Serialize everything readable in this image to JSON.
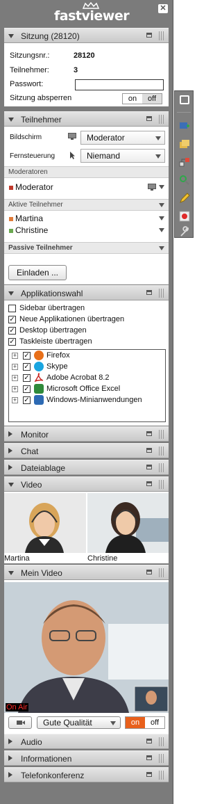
{
  "app": {
    "logo": "fastviewer",
    "close_glyph": "✕"
  },
  "sitzung": {
    "title": "Sitzung (28120)",
    "nr_label": "Sitzungsnr.:",
    "nr_value": "28120",
    "teilnehmer_label": "Teilnehmer:",
    "teilnehmer_value": "3",
    "passwort_label": "Passwort:",
    "passwort_value": "",
    "absperren_label": "Sitzung absperren",
    "on": "on",
    "off": "off"
  },
  "teilnehmer": {
    "title": "Teilnehmer",
    "bildschirm_label": "Bildschirm",
    "bildschirm_value": "Moderator",
    "fernsteuerung_label": "Fernsteuerung",
    "fernsteuerung_value": "Niemand",
    "moderatoren_header": "Moderatoren",
    "moderator": "Moderator",
    "aktive_header": "Aktive Teilnehmer",
    "aktive": [
      "Martina",
      "Christine"
    ],
    "passive_header": "Passive Teilnehmer",
    "einladen": "Einladen ..."
  },
  "applikationswahl": {
    "title": "Applikationswahl",
    "options": [
      {
        "label": "Sidebar übertragen",
        "checked": false
      },
      {
        "label": "Neue Applikationen übertragen",
        "checked": true
      },
      {
        "label": "Desktop übertragen",
        "checked": true
      },
      {
        "label": "Taskleiste übertragen",
        "checked": true
      }
    ],
    "apps": [
      {
        "label": "Firefox",
        "icon": "firefox-icon",
        "color": "#e8701a"
      },
      {
        "label": "Skype",
        "icon": "skype-icon",
        "color": "#1aa5e0"
      },
      {
        "label": "Adobe Acrobat 8.2",
        "icon": "acrobat-icon",
        "color": "#c8231f"
      },
      {
        "label": "Microsoft Office Excel",
        "icon": "excel-icon",
        "color": "#2f8a3a"
      },
      {
        "label": "Windows-Minianwendungen",
        "icon": "gadgets-icon",
        "color": "#2d6ab3"
      }
    ]
  },
  "sections": {
    "monitor": "Monitor",
    "chat": "Chat",
    "dateiablage": "Dateiablage",
    "video": "Video",
    "mein_video": "Mein Video",
    "audio": "Audio",
    "informationen": "Informationen",
    "telefonkonferenz": "Telefonkonferenz"
  },
  "video": {
    "participants": [
      "Martina",
      "Christine"
    ]
  },
  "mein_video": {
    "on_air": "On Air",
    "quality": "Gute Qualität",
    "on": "on",
    "off": "off"
  },
  "colors": {
    "moderator_dot": "#c0392b",
    "martina_dot": "#e07b39",
    "christine_dot": "#6aa84f",
    "on_active": "#e8601c"
  }
}
